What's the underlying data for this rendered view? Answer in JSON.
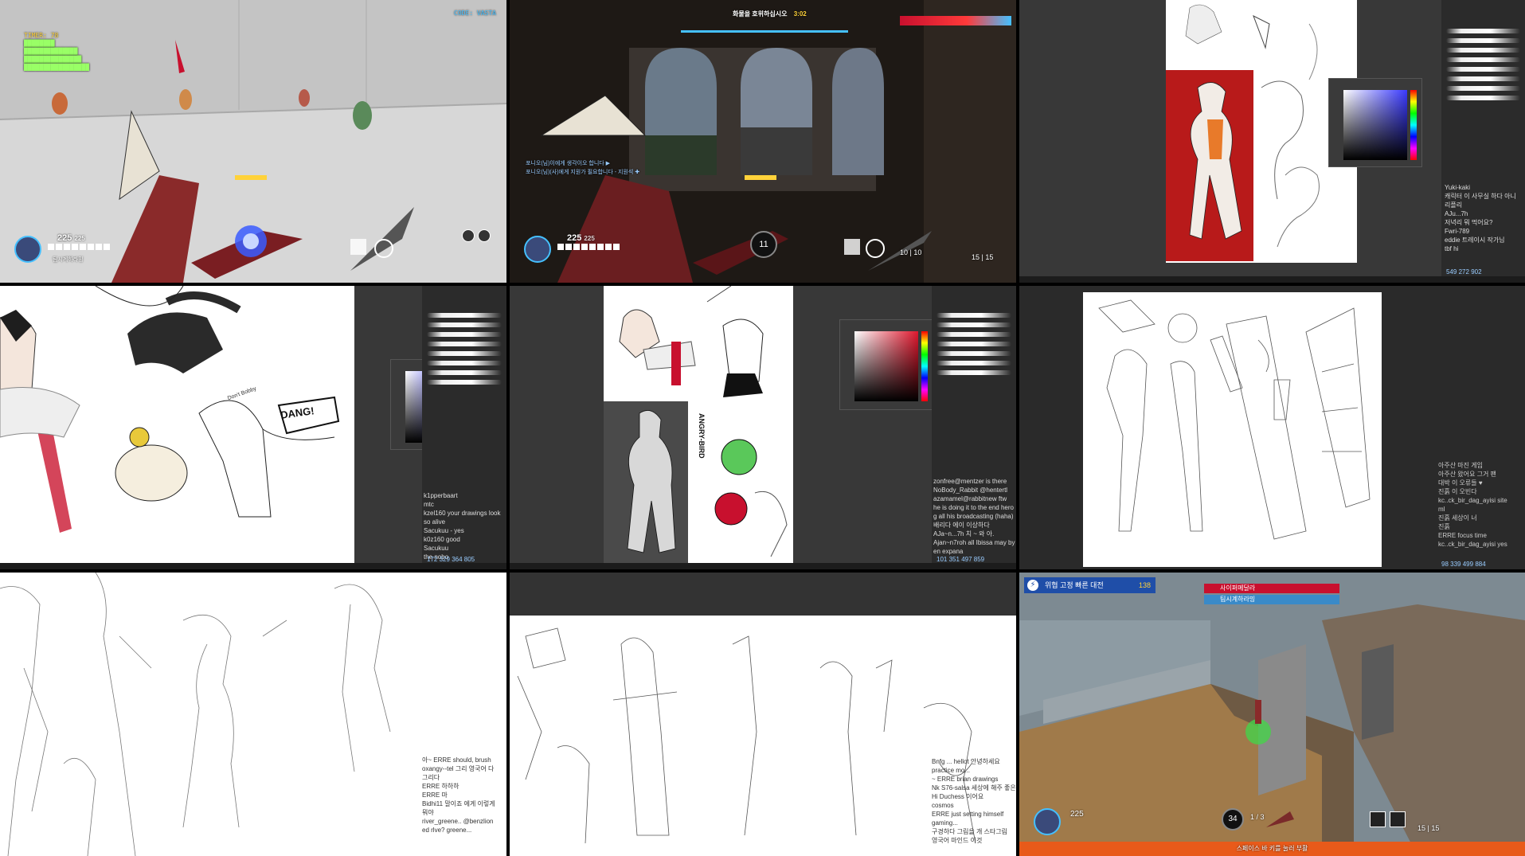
{
  "tile1": {
    "stats": [
      "TIMER: 78",
      "",
      "",
      "",
      ""
    ],
    "code": "CODE: VASTA",
    "health": "225",
    "health_max": "225",
    "player_name": "팀시계하라밍"
  },
  "tile2": {
    "objective": "화물을 호위하십시오",
    "timer": "3:02",
    "health": "225",
    "health_max": "225",
    "ammo": "10 | 10",
    "ammo2": "15 | 15",
    "ult": "11",
    "messages": [
      "포니오(님)이에게 생각이오 합니다 ▶",
      "포니오(님)(사)에게 지원가 필요합니다 - 지원석 ✚"
    ]
  },
  "tile3": {
    "chat": [
      "Yuki-kaki",
      "캐릭터 이 사무실 하다 아니",
      "리플리",
      "AJu...7h",
      "저녁리 뭐 먹어요?",
      "Fwri-789",
      "eddie 트레이시 작가님",
      "tbf hi"
    ],
    "counts": [
      "549",
      "272",
      "902"
    ]
  },
  "tile4": {
    "sticker": "DANG!",
    "sign_text": "Don't Bobby",
    "chat": [
      "k1pperbaart",
      "mtc",
      "kzel160 your drawings look",
      "so alive",
      "Sacukuu - yes",
      "k0z160 good",
      "Sacukuu",
      "the nobo"
    ],
    "counts": [
      "172",
      "329",
      "364",
      "805"
    ]
  },
  "tile5": {
    "vertical_text": "ANGRY-BIRD",
    "chat": [
      "zonfree@mentzer is there",
      "NoBody_Rabbit @hentertl",
      "azamamel@rabbitnew ftw",
      "he is doing it to the end hero",
      "g all his broadcasting (haha)",
      "배리다 에이 이상하다",
      "AJa~n...7h 치 ~ 와 아.",
      "Ajan~n7roh all Ibissa may by",
      "en expana"
    ],
    "counts": [
      "101",
      "351",
      "497",
      "859"
    ]
  },
  "tile6": {
    "chat": [
      "아주산 마진 게임",
      "아주산 왔어요 그거 팬",
      "대박 이 오류들 ♥",
      "진흙 이 오빈다",
      "kc..ck_bir_dag_ayisi site",
      "ml",
      "진흙 세상이 너",
      "진흙",
      "ERRE focus time",
      "kc..ck_bir_dag_ayisi yes"
    ],
    "counts": [
      "98",
      "339",
      "499",
      "884"
    ]
  },
  "tile7": {
    "chat": [
      "아~ ERRE should, brush",
      "oxangy--tel 그리 영국어 다",
      "그리다",
      "ERRE 하하하",
      "ERRE 마",
      "Bidhi11 말이죠 에게 이렇게",
      "뭐야",
      "river_greene.. @benzlion",
      "ed rlve? greene..."
    ]
  },
  "tile8": {
    "chat": [
      "Bnfg ... hellot 안녕하세요",
      "practice mo...",
      "~ ERRE brian drawings",
      "Nk S76-salsa 세상에 해주 좋은",
      "Hi Duchess 이어요",
      "cosmos",
      "ERRE just setting himself",
      "gaming...",
      "구경하다 그림을 개 스타그림",
      "영국어 마인드 이것"
    ]
  },
  "tile9": {
    "banner": "위협 고정 빠른 대전",
    "banner_count": "138",
    "team_a": "사이퍼메달라",
    "team_b": "팀시계하라밍",
    "health": "225",
    "ult": "34",
    "ammo": "1 / 3",
    "ammo2": "15 | 15",
    "hint": "스페이스 바 키를 눌러 부활"
  },
  "colors": {
    "accent_red": "#c8102e",
    "hud_blue": "#45c0ff",
    "hud_yellow": "#ffd23a",
    "panel_dark": "#2b2b2b"
  }
}
